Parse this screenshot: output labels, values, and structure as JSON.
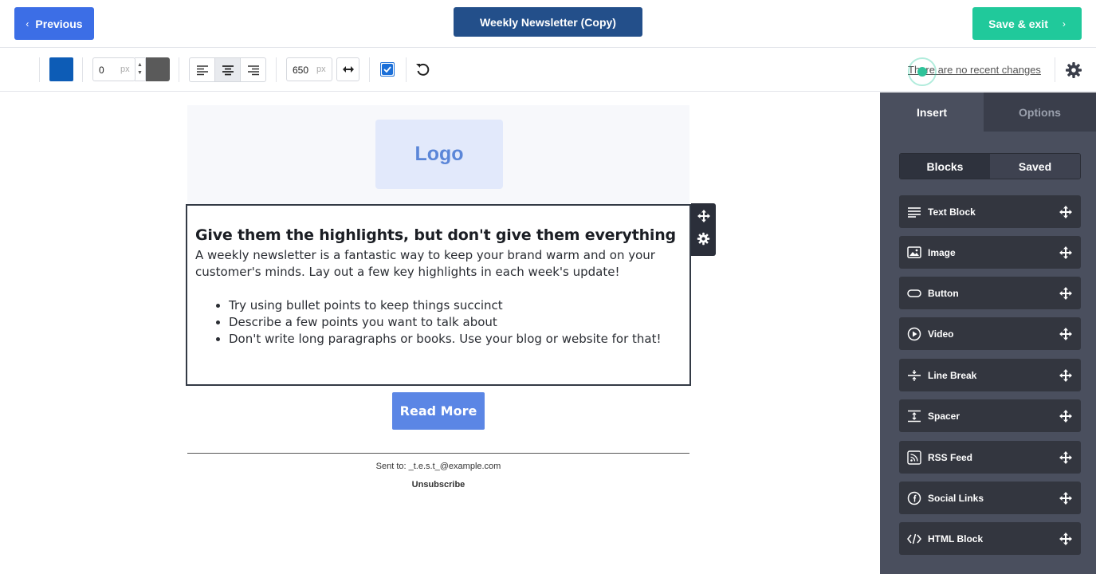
{
  "topbar": {
    "previous_label": "Previous",
    "title": "Weekly Newsletter (Copy)",
    "save_label": "Save & exit"
  },
  "toolbar": {
    "border_color": "#0d5cb6",
    "border_width_value": "0",
    "border_width_unit": "px",
    "border_style_color": "#5a5a5a",
    "alignment_selected": "center",
    "content_width_value": "650",
    "content_width_unit": "px",
    "checkbox_checked": true,
    "recent_changes": "There are no recent changes"
  },
  "email": {
    "logo_text": "Logo",
    "heading": "Give them the highlights, but don't give them everything",
    "intro": "A weekly newsletter is a fantastic way to keep your brand warm and on your customer's minds. Lay out a few key highlights in each week's update!",
    "bullets": [
      "Try using bullet points to keep things succinct",
      "Describe a few points you want to talk about",
      "Don't write long paragraphs or books. Use your blog or website for that!"
    ],
    "cta_label": "Read More",
    "sent_to": "Sent to: _t.e.s.t_@example.com",
    "unsubscribe": "Unsubscribe"
  },
  "panel": {
    "tabs": [
      {
        "label": "Insert",
        "active": true
      },
      {
        "label": "Options",
        "active": false
      }
    ],
    "segments": [
      {
        "label": "Blocks",
        "active": true
      },
      {
        "label": "Saved",
        "active": false
      }
    ],
    "blocks": [
      {
        "label": "Text Block",
        "icon": "text-lines-icon"
      },
      {
        "label": "Image",
        "icon": "image-icon"
      },
      {
        "label": "Button",
        "icon": "button-pill-icon"
      },
      {
        "label": "Video",
        "icon": "play-circle-icon"
      },
      {
        "label": "Line Break",
        "icon": "line-break-icon"
      },
      {
        "label": "Spacer",
        "icon": "spacer-icon"
      },
      {
        "label": "RSS Feed",
        "icon": "rss-icon"
      },
      {
        "label": "Social Links",
        "icon": "facebook-circle-icon"
      },
      {
        "label": "HTML Block",
        "icon": "code-icon"
      }
    ]
  },
  "colors": {
    "primary": "#3c6ee6",
    "title_bg": "#234f8a",
    "save": "#20c99b",
    "panel": "#4a4f5e",
    "cta": "#5b86e5"
  }
}
